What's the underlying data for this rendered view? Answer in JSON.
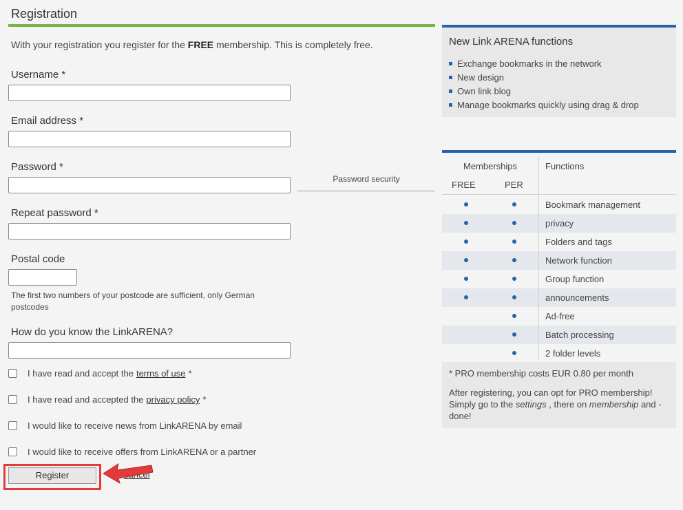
{
  "form": {
    "title": "Registration",
    "intro_prefix": "With your registration you register for the ",
    "intro_bold": "FREE",
    "intro_suffix": " membership. This is completely free.",
    "fields": {
      "username": "Username *",
      "email": "Email address *",
      "password": "Password *",
      "repeat_password": "Repeat password *",
      "postal_code": "Postal code",
      "how_know": "How do you know the LinkARENA?"
    },
    "password_security": "Password security",
    "postal_hint": "The first two numbers of your postcode are sufficient, only German postcodes",
    "checkboxes": {
      "terms_prefix": "I have read and accept the",
      "terms_link": "terms of use",
      "privacy_prefix": "I have read and accepted the",
      "privacy_link": "privacy policy",
      "required_mark": "*",
      "news": "I would like to receive news from LinkARENA by email",
      "offers": "I would like to receive offers from LinkARENA or a partner"
    },
    "register_label": "Register",
    "cancel_label": "cancel"
  },
  "side": {
    "title": "New Link ARENA functions",
    "items": [
      "Exchange bookmarks in the network",
      "New design",
      "Own link blog",
      "Manage bookmarks quickly using drag & drop"
    ],
    "table": {
      "memberships": "Memberships",
      "free": "FREE",
      "per": "PER",
      "functions": "Functions",
      "rows": [
        "Bookmark management",
        "privacy",
        "Folders and tags",
        "Network function",
        "Group function",
        "announcements",
        "Ad-free",
        "Batch processing",
        "2 folder levels"
      ]
    },
    "pro_note": "* PRO membership costs EUR 0.80 per month",
    "after_1": "After registering, you can opt for PRO membership! Simply go to the ",
    "after_settings": "settings",
    "after_2": " , there on ",
    "after_membership": "membership",
    "after_3": " and - done!"
  },
  "colors": {
    "accent_green": "#7cb24a",
    "accent_blue": "#2762ac",
    "highlight_red": "#e23b3b"
  }
}
